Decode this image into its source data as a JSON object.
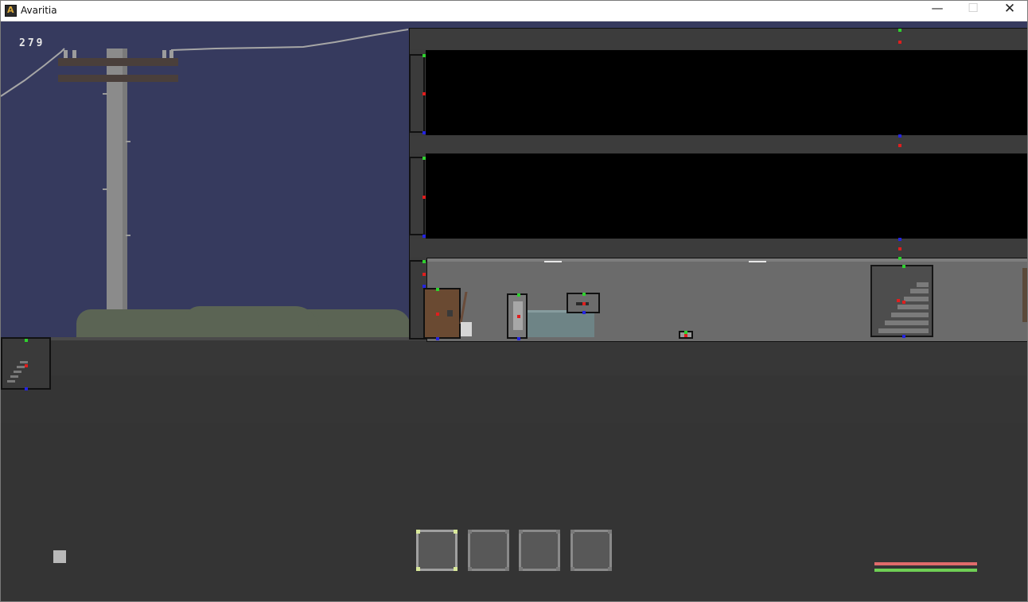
{
  "window": {
    "title": "Avaritia",
    "app_icon_letter": "A",
    "minimize_glyph": "—",
    "maximize_glyph": "☐",
    "close_glyph": "✕"
  },
  "hud": {
    "counter": "279",
    "hotbar": {
      "slot_count": 4,
      "selected_index": 0
    },
    "health_fraction": 1.0,
    "stamina_fraction": 1.0
  },
  "colors": {
    "sky": "#363a5e",
    "health": "#e06b6b",
    "stamina": "#6fcf55",
    "debug_top": "#2fd12f",
    "debug_center": "#e01e1e",
    "debug_bottom": "#2424e0"
  },
  "icons": {
    "app": "avaritia-logo-icon",
    "minimize": "minimize-icon",
    "maximize": "maximize-icon",
    "close": "close-icon"
  }
}
